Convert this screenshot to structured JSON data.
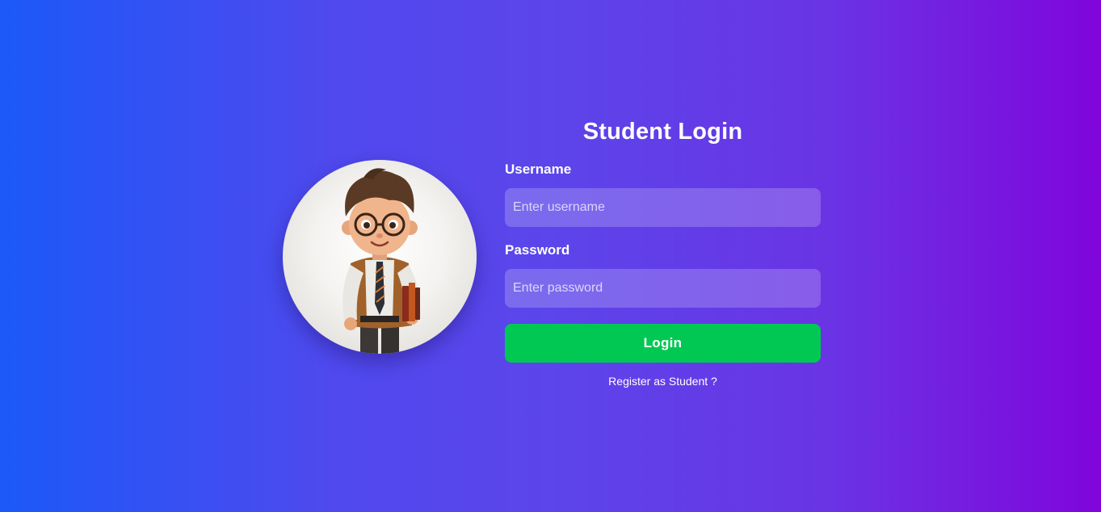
{
  "login": {
    "title": "Student Login",
    "username_label": "Username",
    "username_placeholder": "Enter username",
    "username_value": "",
    "password_label": "Password",
    "password_placeholder": "Enter password",
    "password_value": "",
    "button_label": "Login",
    "register_link": "Register as Student ?"
  },
  "avatar": {
    "icon": "student-avatar-illustration"
  },
  "colors": {
    "background_start": "#1b59f8",
    "background_end": "#8005dc",
    "button": "#00c853",
    "text": "#ffffff"
  }
}
